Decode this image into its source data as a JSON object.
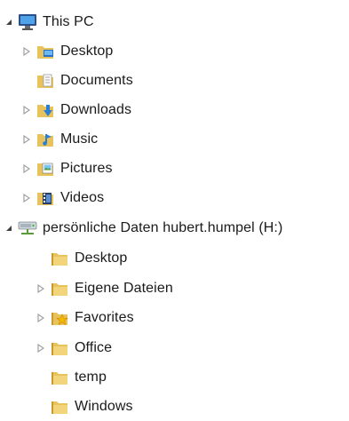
{
  "tree": {
    "this_pc": {
      "label": "This PC",
      "icon": "computer-icon",
      "expanded": true
    },
    "this_pc_children": [
      {
        "label": "Desktop",
        "icon": "desktop-folder-icon",
        "has_children": true
      },
      {
        "label": "Documents",
        "icon": "documents-folder-icon",
        "has_children": false
      },
      {
        "label": "Downloads",
        "icon": "downloads-folder-icon",
        "has_children": true
      },
      {
        "label": "Music",
        "icon": "music-folder-icon",
        "has_children": true
      },
      {
        "label": "Pictures",
        "icon": "pictures-folder-icon",
        "has_children": true
      },
      {
        "label": "Videos",
        "icon": "videos-folder-icon",
        "has_children": true
      }
    ],
    "network_drive": {
      "label": "persönliche Daten hubert.humpel (H:)",
      "icon": "network-drive-icon",
      "expanded": true
    },
    "drive_children": [
      {
        "label": "Desktop",
        "icon": "folder-icon",
        "has_children": false
      },
      {
        "label": "Eigene Dateien",
        "icon": "folder-icon",
        "has_children": true
      },
      {
        "label": "Favorites",
        "icon": "favorites-folder-icon",
        "has_children": true
      },
      {
        "label": "Office",
        "icon": "folder-icon",
        "has_children": true
      },
      {
        "label": "temp",
        "icon": "folder-icon",
        "has_children": false
      },
      {
        "label": "Windows",
        "icon": "folder-icon",
        "has_children": false
      }
    ]
  },
  "colors": {
    "folder": "#e8c25a",
    "folder_dark": "#c99a2e",
    "arrow": "#a0a0a0",
    "arrow_expanded": "#404040"
  }
}
